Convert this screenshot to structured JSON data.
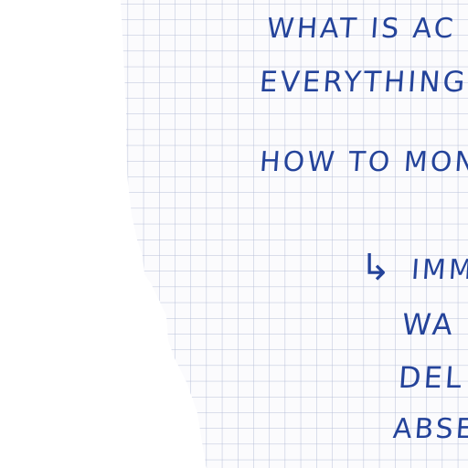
{
  "page": {
    "ink_color": "#24439a",
    "grid_color": "#b7bfd8",
    "paper_color": "#fbfbfd"
  },
  "notes": {
    "line1": "WHAT IS AC",
    "line2": "EVERYTHING",
    "line3": "HOW TO MON",
    "arrow_icon": "curved-arrow-icon",
    "arrow_glyph": "↳",
    "line4": "IMM",
    "line5": "WA",
    "line6": "DEL",
    "line7": "ABSE"
  }
}
